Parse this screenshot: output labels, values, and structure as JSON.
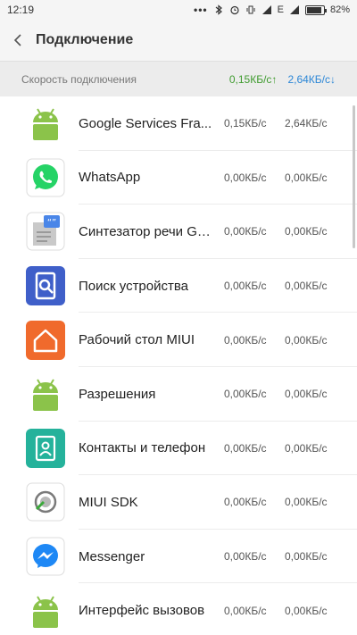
{
  "status_bar": {
    "time": "12:19",
    "network": "E",
    "battery": "82%",
    "battery_level": 0.82
  },
  "header": {
    "title": "Подключение"
  },
  "summary": {
    "label": "Скорость подключения",
    "upload": "0,15КБ/с↑",
    "download": "2,64КБ/с↓"
  },
  "apps": [
    {
      "name": "Google Services Fra...",
      "col1": "0,15КБ/с",
      "col2": "2,64КБ/с",
      "icon": "android-icon"
    },
    {
      "name": "WhatsApp",
      "col1": "0,00КБ/с",
      "col2": "0,00КБ/с",
      "icon": "whatsapp-icon"
    },
    {
      "name": "Синтезатор речи Go...",
      "col1": "0,00КБ/с",
      "col2": "0,00КБ/с",
      "icon": "tts-icon"
    },
    {
      "name": "Поиск устройства",
      "col1": "0,00КБ/с",
      "col2": "0,00КБ/с",
      "icon": "find-device-icon"
    },
    {
      "name": "Рабочий стол MIUI",
      "col1": "0,00КБ/с",
      "col2": "0,00КБ/с",
      "icon": "home-icon"
    },
    {
      "name": "Разрешения",
      "col1": "0,00КБ/с",
      "col2": "0,00КБ/с",
      "icon": "android-icon"
    },
    {
      "name": "Контакты и телефон",
      "col1": "0,00КБ/с",
      "col2": "0,00КБ/с",
      "icon": "contacts-icon"
    },
    {
      "name": "MIUI SDK",
      "col1": "0,00КБ/с",
      "col2": "0,00КБ/с",
      "icon": "miui-sdk-icon"
    },
    {
      "name": "Messenger",
      "col1": "0,00КБ/с",
      "col2": "0,00КБ/с",
      "icon": "messenger-icon"
    },
    {
      "name": "Интерфейс вызовов",
      "col1": "0,00КБ/с",
      "col2": "0,00КБ/с",
      "icon": "android-icon"
    }
  ],
  "colors": {
    "upload": "#3f9b2f",
    "download": "#2b86d6",
    "android": "#8bc34a",
    "whatsapp": "#25d366",
    "find_device": "#3f5fc9",
    "home": "#f06a2c",
    "contacts": "#25b29b",
    "messenger": "#1e88f5"
  }
}
